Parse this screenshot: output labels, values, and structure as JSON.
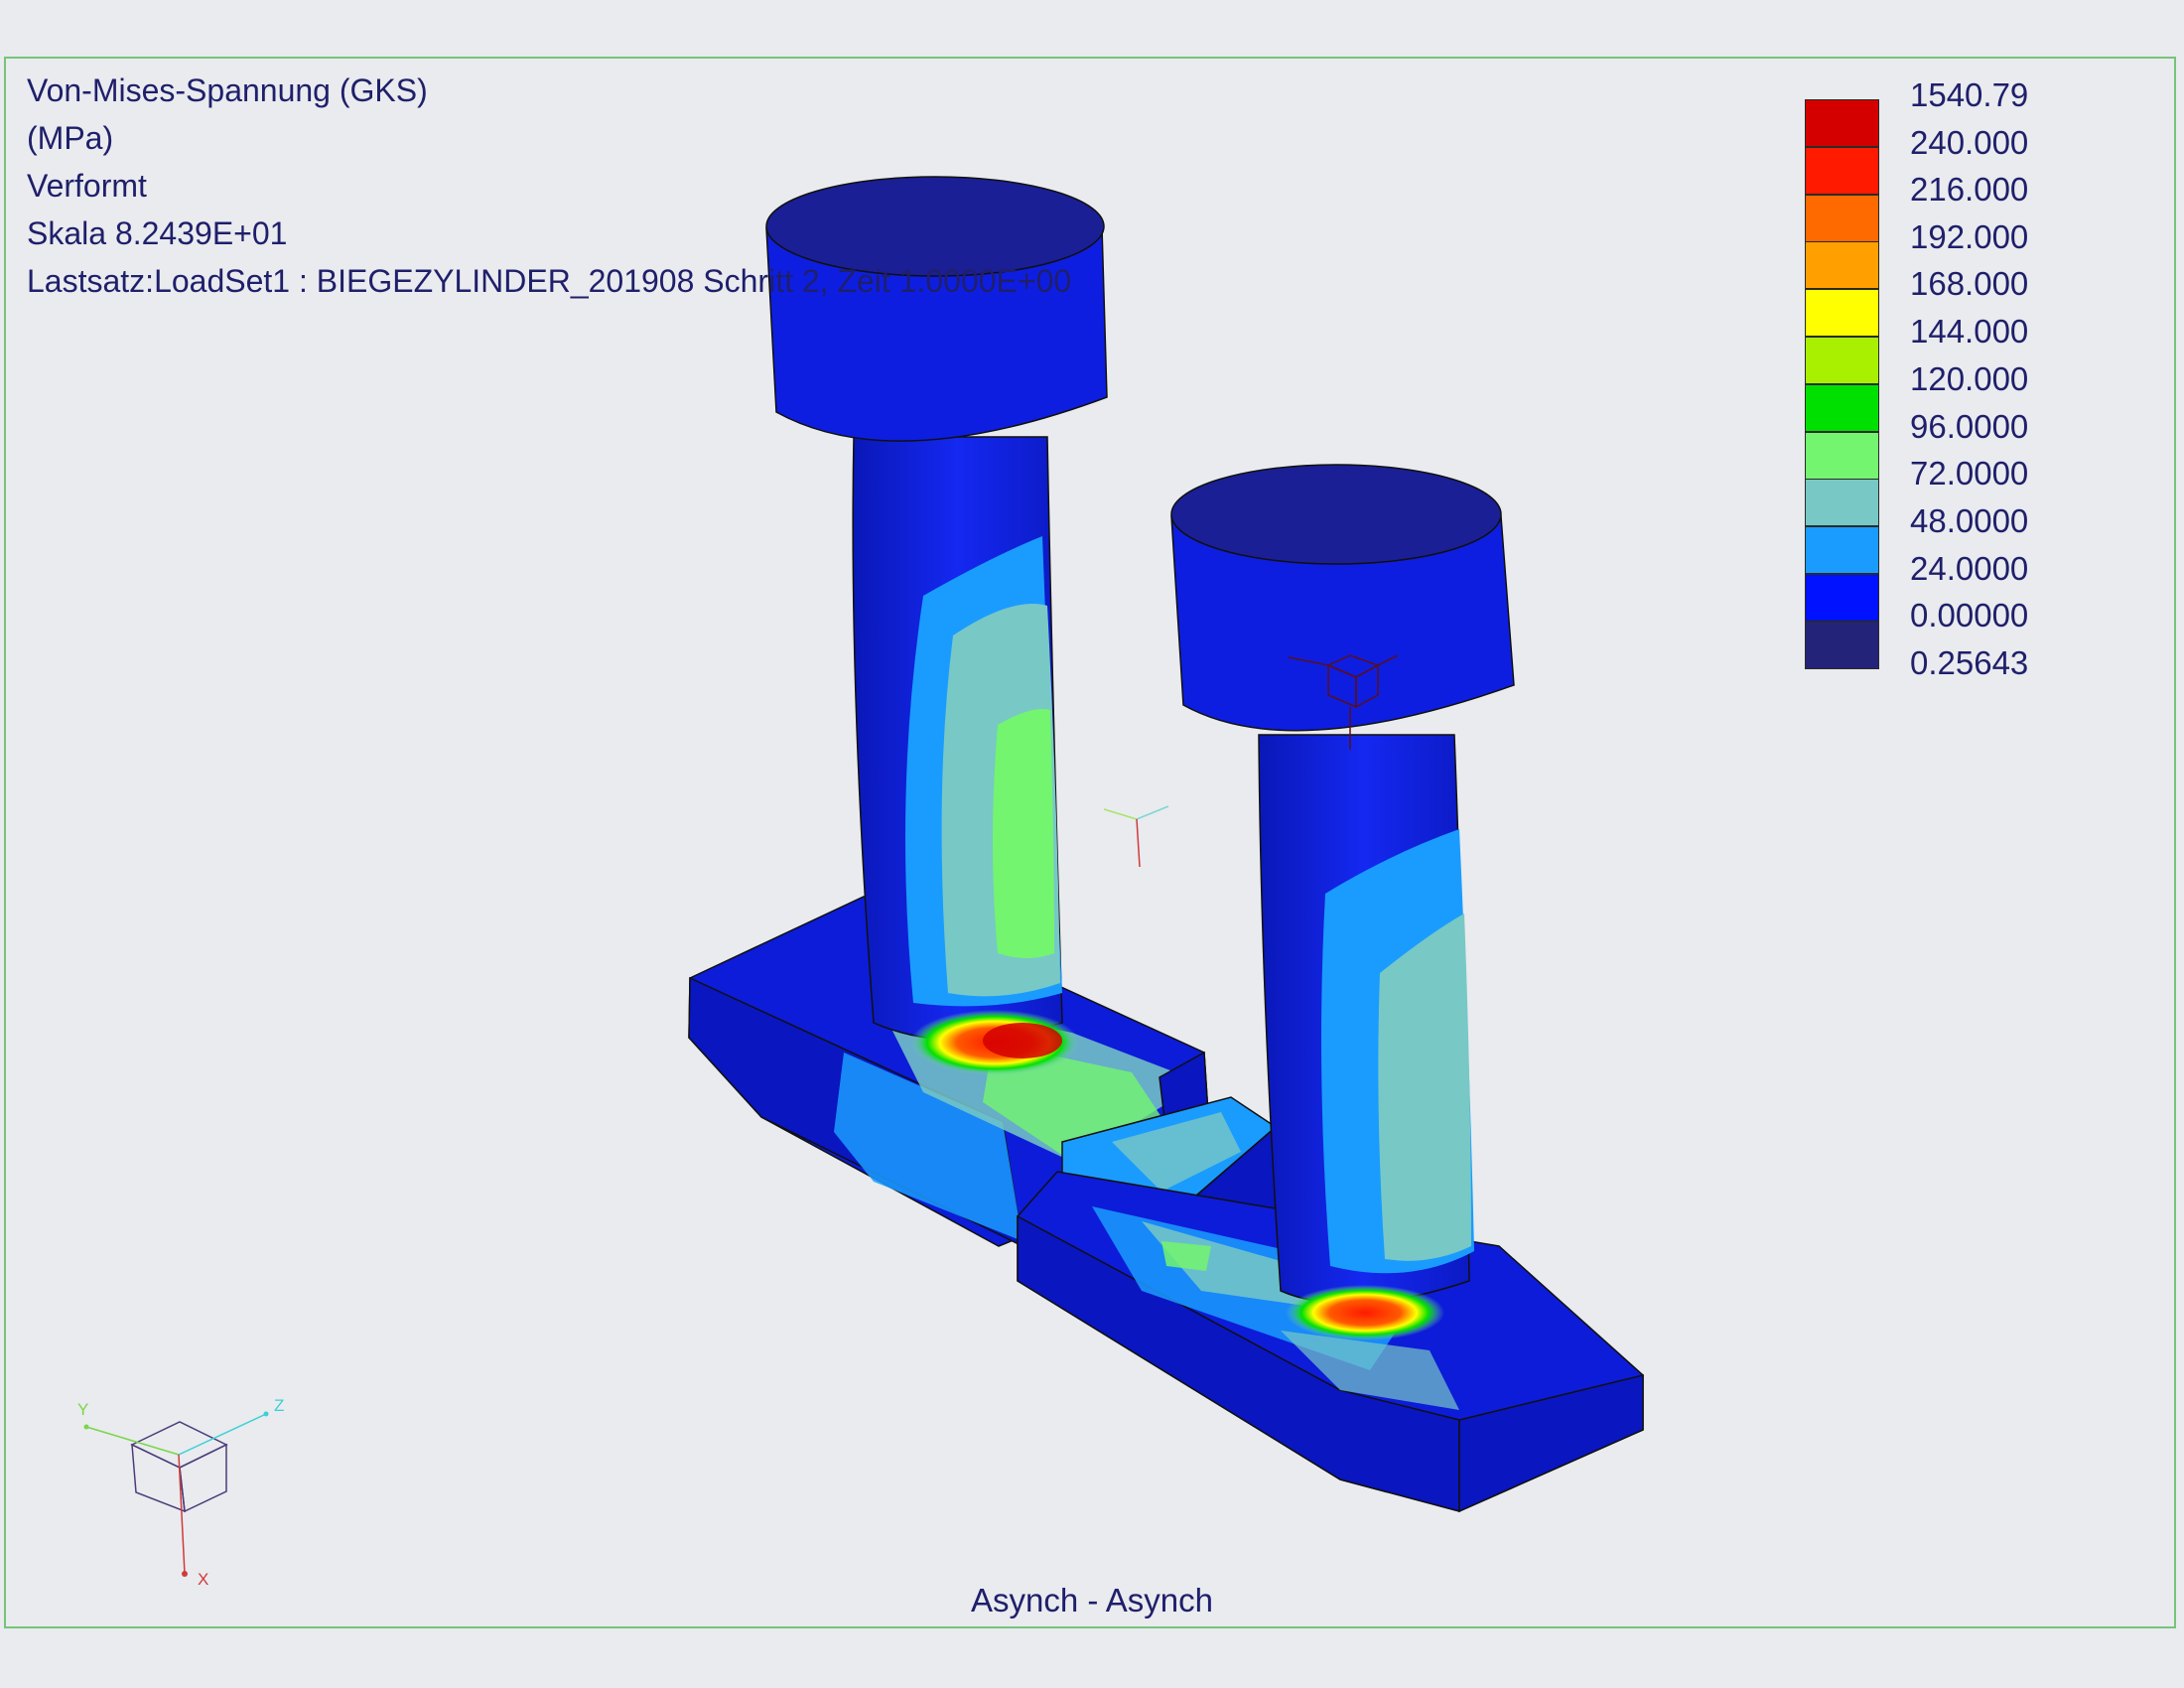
{
  "info": {
    "line1": "Von-Mises-Spannung (GKS)",
    "line2": "(MPa)",
    "line3": "Verformt",
    "line4": "Skala  8.2439E+01",
    "line5": "Lastsatz:LoadSet1 :  BIEGEZYLINDER_201908 Schritt 2, Zeit  1.0000E+00"
  },
  "legend": {
    "labels": [
      "1540.79",
      "240.000",
      "216.000",
      "192.000",
      "168.000",
      "144.000",
      "120.000",
      "96.0000",
      "72.0000",
      "48.0000",
      "24.0000",
      "0.00000",
      "0.25643"
    ],
    "colors": [
      "#d40000",
      "#ff1a00",
      "#ff6a00",
      "#ffa000",
      "#ffff00",
      "#a8f000",
      "#00e000",
      "#73f56f",
      "#78c8c6",
      "#1a9cff",
      "#0012ff",
      "#23237a"
    ]
  },
  "view_triad": {
    "x": "X",
    "y": "Y",
    "z": "Z"
  },
  "footer": "Asynch - Asynch"
}
